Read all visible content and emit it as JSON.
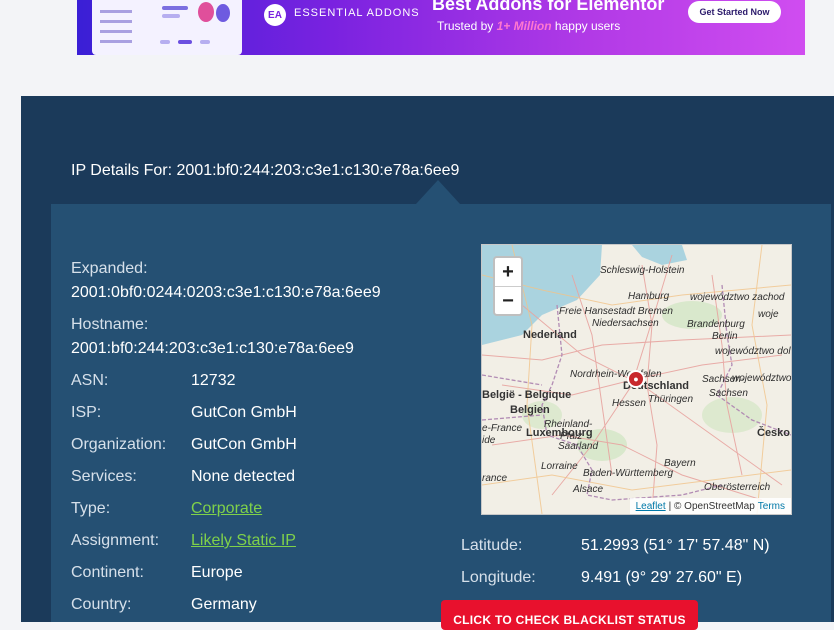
{
  "banner": {
    "logo_text": "EA",
    "brand": "ESSENTIAL ADDONS",
    "title": "Best Addons for Elementor",
    "subtitle_pre": "Trusted by ",
    "subtitle_highlight": "1+ Million",
    "subtitle_post": " happy users",
    "cta": "Get Started Now",
    "colors": {
      "gradient_start": "#3a1fd6",
      "gradient_end": "#d04df0",
      "highlight": "#ff77d0"
    }
  },
  "header": {
    "title": "IP Details For: 2001:bf0:244:203:c3e1:c130:e78a:6ee9"
  },
  "details": {
    "expanded_label": "Expanded:",
    "expanded_value": "2001:0bf0:0244:0203:c3e1:c130:e78a:6ee9",
    "hostname_label": "Hostname:",
    "hostname_value": "2001:bf0:244:203:c3e1:c130:e78a:6ee9",
    "asn_label": "ASN:",
    "asn_value": "12732",
    "isp_label": "ISP:",
    "isp_value": "GutCon GmbH",
    "org_label": "Organization:",
    "org_value": "GutCon GmbH",
    "services_label": "Services:",
    "services_value": "None detected",
    "type_label": "Type:",
    "type_value": "Corporate",
    "assignment_label": "Assignment:",
    "assignment_value": "Likely Static IP",
    "continent_label": "Continent:",
    "continent_value": "Europe",
    "country_label": "Country:",
    "country_value": "Germany"
  },
  "coords": {
    "latitude_label": "Latitude:",
    "latitude_value": "51.2993  (51° 17' 57.48\" N)",
    "longitude_label": "Longitude:",
    "longitude_value": "9.491  (9° 29' 27.60\" E)"
  },
  "map": {
    "zoom_in": "+",
    "zoom_out": "−",
    "attribution_leaflet": "Leaflet",
    "attribution_sep": "| © OpenStreetMap",
    "attribution_terms": "Terms",
    "labels": {
      "schleswig": "Schleswig-Holstein",
      "hamburg": "Hamburg",
      "woj_zach": "województwo zachod",
      "freie": "Freie Hansestadt Bremen",
      "nieder": "Niedersachsen",
      "woj": "woje",
      "nederland": "Nederland",
      "brandenburg": "Brandenburg",
      "berlin": "Berlin",
      "woj_dol": "województwo dol",
      "nrw": "Nordrhein-Westfalen",
      "deutschland": "Deutschland",
      "sachsen_anhalt": "Sachsen-",
      "woj2": "województwo",
      "belgie": "België - Belgique",
      "hessen": "Hessen",
      "thuringen": "Thüringen",
      "sachsen": "Sachsen",
      "belgien": "Belgien",
      "ledefrance": "e-France",
      "luxembourg": "Luxembourg",
      "rheinland": "Rheinland-",
      "pfalz": "Pfalz",
      "cesko": "Česko",
      "saarland": "Saarland",
      "ide": "ide",
      "lorraine": "Lorraine",
      "bayern": "Bayern",
      "bawu": "Baden-Württemberg",
      "rance": "rance",
      "alsace": "Alsace",
      "ober": "Oberösterreich"
    },
    "marker_icon": "map-marker"
  },
  "cta": {
    "label": "CLICK TO CHECK BLACKLIST STATUS",
    "color": "#e8112d"
  },
  "colors": {
    "panel": "#1b3a5a",
    "content": "#255073",
    "link": "#7fd14a"
  }
}
